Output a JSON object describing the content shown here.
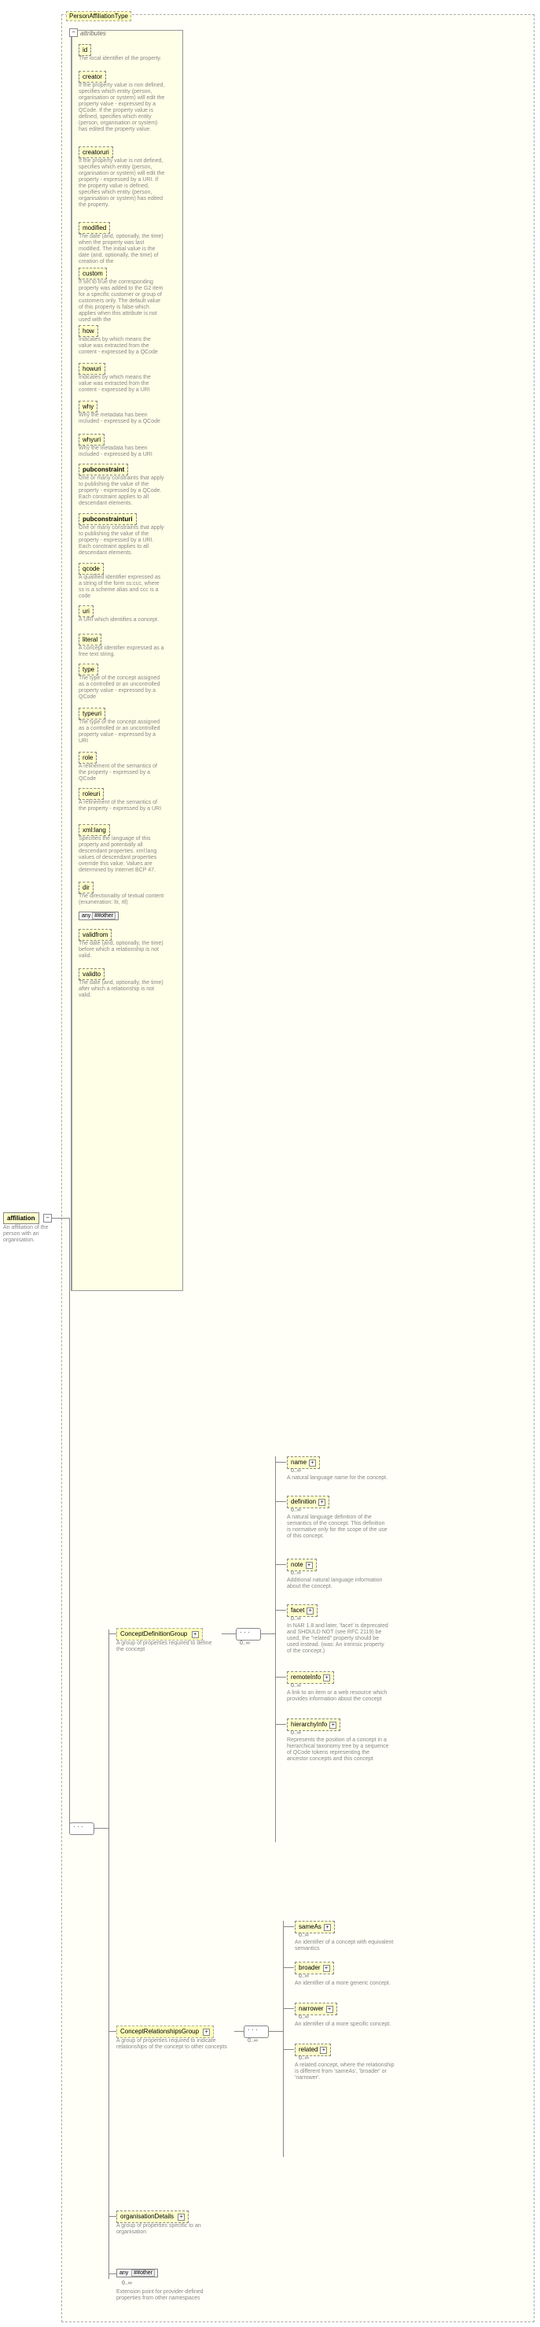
{
  "root": {
    "name": "affiliation",
    "desc": "An affiliation of the person with an organisation."
  },
  "container_title": "PersonAffiliationType",
  "attributes_label": "attributes",
  "attrs": [
    {
      "name": "id",
      "desc": "The local identifier of the property."
    },
    {
      "name": "creator",
      "desc": "If the property value is non defined, specifies which entity (person, organisation or system) will edit the property value - expressed by a QCode. If the property value is defined, specifies which entity (person, organisation or system) has edited the property value."
    },
    {
      "name": "creatoruri",
      "desc": "If the property value is not defined, specifies which entity (person, organisation or system) will edit the property - expressed by a URI. If the property value is defined, specifies which entity (person, organisation or system) has edited the property."
    },
    {
      "name": "modified",
      "desc": "The date (and, optionally, the time) when the property was last modified. The initial value is the date (and, optionally, the time) of creation of the"
    },
    {
      "name": "custom",
      "desc": "If set to true the corresponding property was added to the G2 item for a specific customer or group of customers only. The default value of this property is false which applies when this attribute is not used with the"
    },
    {
      "name": "how",
      "desc": "Indicates by which means the value was extracted from the content - expressed by a QCode"
    },
    {
      "name": "howuri",
      "desc": "Indicates by which means the value was extracted from the content - expressed by a URI"
    },
    {
      "name": "why",
      "desc": "Why the metadata has been included - expressed by a QCode"
    },
    {
      "name": "whyuri",
      "desc": "Why the metadata has been included - expressed by a URI"
    },
    {
      "name": "pubconstraint",
      "bold": true,
      "desc": "One or many constraints that apply to publishing the value of the property - expressed by a QCode. Each constraint applies to all descendant elements."
    },
    {
      "name": "pubconstrainturi",
      "bold": true,
      "desc": "One or many constraints that apply to publishing the value of the property - expressed by a URI. Each constraint applies to all descendant elements."
    },
    {
      "name": "qcode",
      "desc": "A qualified identifier expressed as a string of the form ss:ccc, where ss is a scheme alias and ccc is a code"
    },
    {
      "name": "uri",
      "desc": "A URI which identifies a concept."
    },
    {
      "name": "literal",
      "desc": "A concept identifier expressed as a free text string."
    },
    {
      "name": "type",
      "desc": "The type of the concept assigned as a controlled or an uncontrolled property value - expressed by a QCode"
    },
    {
      "name": "typeuri",
      "desc": "The type of the concept assigned as a controlled or an uncontrolled property value - expressed by a URI"
    },
    {
      "name": "role",
      "desc": "A refinement of the semantics of the property - expressed by a QCode"
    },
    {
      "name": "roleuri",
      "desc": "A refinement of the semantics of the property - expressed by a URI"
    },
    {
      "name": "xml:lang",
      "desc": "Specifies the language of this property and potentially all descendant properties. xml:lang values of descendant properties override this value. Values are determined by Internet BCP 47."
    },
    {
      "name": "dir",
      "desc": "The directionality of textual content (enumeration: ltr, rtl)"
    }
  ],
  "any_other": "##other",
  "post_attrs": [
    {
      "name": "validfrom",
      "desc": "The date (and, optionally, the time) before which a relationship is not valid."
    },
    {
      "name": "validto",
      "desc": "The date (and, optionally, the time) after which a relationship is not valid."
    }
  ],
  "group1": {
    "title": "ConceptDefinitionGroup",
    "desc": "A group of properties required to define the concept",
    "children": [
      {
        "name": "name",
        "desc": "A natural language name for the concept."
      },
      {
        "name": "definition",
        "desc": "A natural language definition of the semantics of the concept. This definition is normative only for the scope of the use of this concept."
      },
      {
        "name": "note",
        "desc": "Additional natural language information about the concept."
      },
      {
        "name": "facet",
        "desc": "In NAR 1.8 and later, 'facet' is deprecated and SHOULD NOT (see RFC 2119) be used, the \"related\" property should be used instead. (was: An intrinsic property of the concept.)"
      },
      {
        "name": "remoteInfo",
        "desc": "A link to an item or a web resource which provides information about the concept"
      },
      {
        "name": "hierarchyInfo",
        "desc": "Represents the position of a concept in a hierarchical taxonomy tree by a sequence of QCode tokens representing the ancestor concepts and this concept"
      }
    ]
  },
  "group2": {
    "title": "ConceptRelationshipsGroup",
    "desc": "A group of properties required to indicate relationships of the concept to other concepts",
    "children": [
      {
        "name": "sameAs",
        "desc": "An identifier of a concept with equivalent semantics"
      },
      {
        "name": "broader",
        "desc": "An identifier of a more generic concept."
      },
      {
        "name": "narrower",
        "desc": "An identifier of a more specific concept."
      },
      {
        "name": "related",
        "desc": "A related concept, where the relationship is different from 'sameAs', 'broader' or 'narrower'."
      }
    ]
  },
  "org_details": {
    "name": "organisationDetails",
    "desc": "A group of properties specific to an organisation"
  },
  "ext_any": {
    "label": "##other",
    "desc": "Extension point for provider-defined properties from other namespaces"
  },
  "cardinality": "0..∞",
  "any_word": "any"
}
